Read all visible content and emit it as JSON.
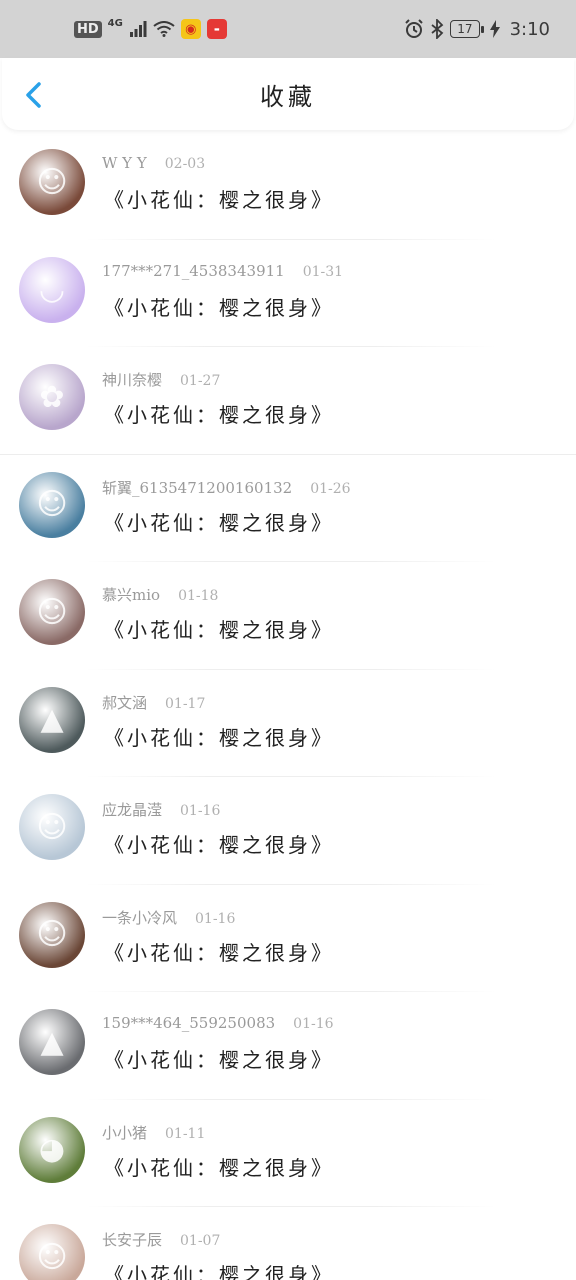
{
  "status_bar": {
    "hd": "HD",
    "network": "4G",
    "battery": "17",
    "time": "3:10",
    "icons": [
      "signal-icon",
      "wifi-icon",
      "weibo-icon",
      "huawei-icon",
      "alarm-icon",
      "bluetooth-icon",
      "battery-icon",
      "charging-icon"
    ]
  },
  "header": {
    "title": "收藏",
    "back_icon": "chevron-left-icon",
    "accent_color": "#2aa1e8"
  },
  "items": [
    {
      "name": "W Y Y",
      "date": "02-03",
      "title": "《小花仙：樱之很身》",
      "avatar_color": "#7a4a3a"
    },
    {
      "name": "177***271_4538343911",
      "date": "01-31",
      "title": "《小花仙：樱之很身》",
      "avatar_color": "#c9b1ee"
    },
    {
      "name": "神川奈樱",
      "date": "01-27",
      "title": "《小花仙：樱之很身》",
      "avatar_color": "#b8a6cc"
    },
    {
      "name": "斩翼_6135471200160132",
      "date": "01-26",
      "title": "《小花仙：樱之很身》",
      "avatar_color": "#4a7fa0"
    },
    {
      "name": "慕兴mio",
      "date": "01-18",
      "title": "《小花仙：樱之很身》",
      "avatar_color": "#8a6a66"
    },
    {
      "name": "郝文涵",
      "date": "01-17",
      "title": "《小花仙：樱之很身》",
      "avatar_color": "#4e5a5c"
    },
    {
      "name": "应龙晶滢",
      "date": "01-16",
      "title": "《小花仙：樱之很身》",
      "avatar_color": "#b7c7d6"
    },
    {
      "name": "一条小冷风",
      "date": "01-16",
      "title": "《小花仙：樱之很身》",
      "avatar_color": "#6a4636"
    },
    {
      "name": "159***464_559250083",
      "date": "01-16",
      "title": "《小花仙：樱之很身》",
      "avatar_color": "#6a6c70"
    },
    {
      "name": "小小猪",
      "date": "01-11",
      "title": "《小花仙：樱之很身》",
      "avatar_color": "#5f7d3a"
    },
    {
      "name": "长安子辰",
      "date": "01-07",
      "title": "《小花仙：樱之很身》",
      "avatar_color": "#c9a89a"
    }
  ]
}
